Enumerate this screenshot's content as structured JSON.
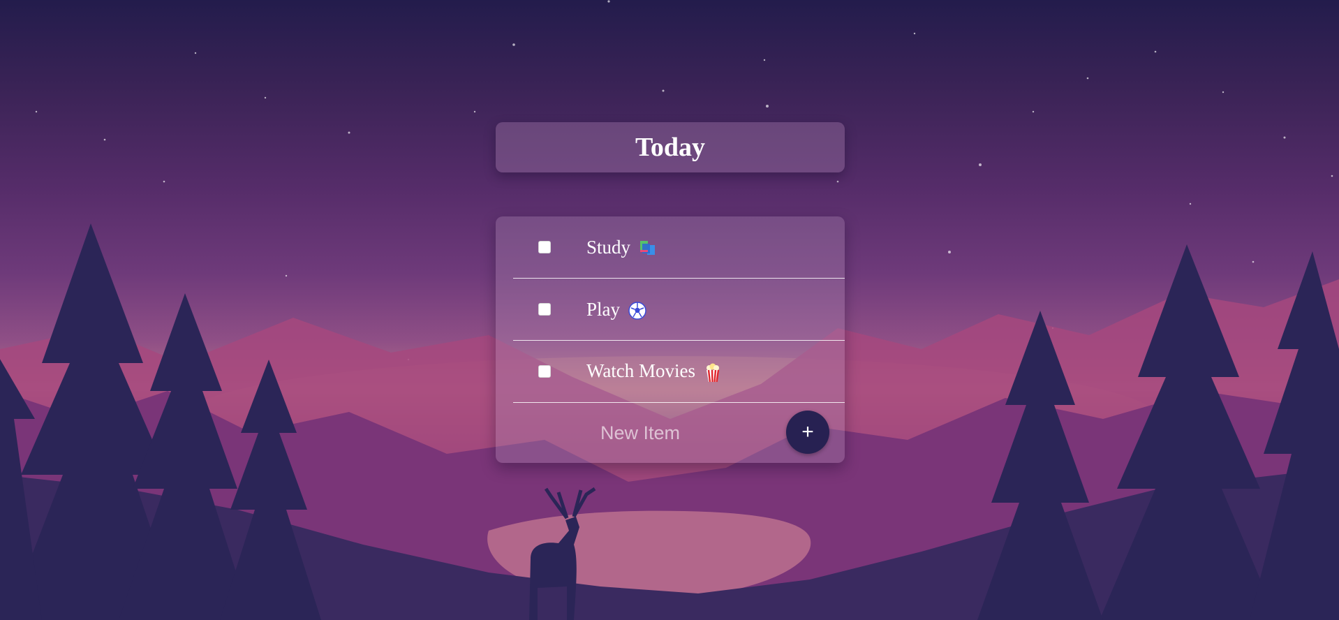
{
  "header": {
    "title": "Today"
  },
  "todo_list": {
    "items": [
      {
        "label": "Study",
        "emoji_icon": "books-icon",
        "checked": false
      },
      {
        "label": "Play",
        "emoji_icon": "soccer-ball-icon",
        "checked": false
      },
      {
        "label": "Watch Movies",
        "emoji_icon": "popcorn-icon",
        "checked": false
      }
    ],
    "new_item": {
      "placeholder": "New Item",
      "value": ""
    },
    "add_button": {
      "label": "+"
    }
  },
  "theme": {
    "card_color": "#96a0a0",
    "button_color": "#272152",
    "text_color": "#ffffff",
    "background": "purple-mountain-night-landscape"
  }
}
